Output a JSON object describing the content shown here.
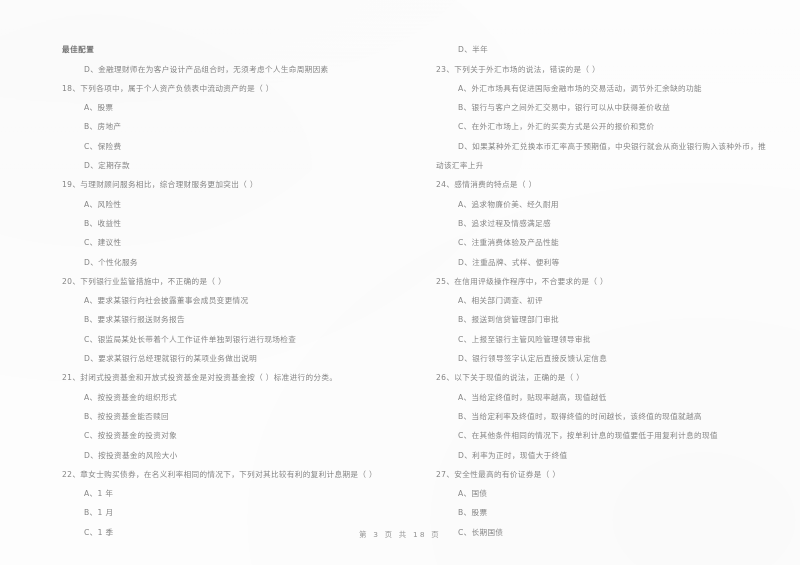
{
  "document": {
    "kind": "scanned-exam-paper",
    "language": "zh-CN",
    "ink_color": "#7b7b7b",
    "page_color": "#fdfdfd"
  },
  "left_column": {
    "lines": [
      {
        "kind": "heading",
        "text": "最佳配置"
      },
      {
        "kind": "option",
        "text": "D、金融理财师在为客户设计产品组合时，无须考虑个人生命周期因素"
      },
      {
        "kind": "stem",
        "text": "18、下列各项中，属于个人资产负债表中流动资产的是（      ）"
      },
      {
        "kind": "option",
        "text": "A、股票"
      },
      {
        "kind": "option",
        "text": "B、房地产"
      },
      {
        "kind": "option",
        "text": "C、保险费"
      },
      {
        "kind": "option",
        "text": "D、定期存款"
      },
      {
        "kind": "stem",
        "text": "19、与理财顾问服务相比，综合理财服务更加突出（      ）"
      },
      {
        "kind": "option",
        "text": "A、风险性"
      },
      {
        "kind": "option",
        "text": "B、收益性"
      },
      {
        "kind": "option",
        "text": "C、建议性"
      },
      {
        "kind": "option",
        "text": "D、个性化服务"
      },
      {
        "kind": "stem",
        "text": "20、下列银行业监管措施中，不正确的是（      ）"
      },
      {
        "kind": "option",
        "text": "A、要求某银行向社会披露董事会成员变更情况"
      },
      {
        "kind": "option",
        "text": "B、要求某银行报送财务报告"
      },
      {
        "kind": "option",
        "text": "C、银监局某处长带着个人工作证件单独到银行进行现场检查"
      },
      {
        "kind": "option",
        "text": "D、要求某银行总经理就银行的某项业务做出说明"
      },
      {
        "kind": "stem",
        "text": "21、封闭式投资基金和开放式投资基金是对投资基金按（      ）标准进行的分类。"
      },
      {
        "kind": "option",
        "text": "A、按投资基金的组织形式"
      },
      {
        "kind": "option",
        "text": "B、按投资基金能否赎回"
      },
      {
        "kind": "option",
        "text": "C、按投资基金的投资对象"
      },
      {
        "kind": "option",
        "text": "D、按投资基金的风险大小"
      },
      {
        "kind": "stem",
        "text": "22、章女士购买债券，在名义利率相同的情况下，下列对其比较有利的复利计息期是（      ）"
      },
      {
        "kind": "option",
        "text": "A、1 年"
      },
      {
        "kind": "option",
        "text": "B、1 月"
      },
      {
        "kind": "option",
        "text": "C、1 季"
      }
    ]
  },
  "right_column": {
    "lines": [
      {
        "kind": "option",
        "text": "D、半年"
      },
      {
        "kind": "stem",
        "text": "23、下列关于外汇市场的说法，错误的是（      ）"
      },
      {
        "kind": "option",
        "text": "A、外汇市场具有促进国际金融市场的交易活动，调节外汇余缺的功能"
      },
      {
        "kind": "option",
        "text": "B、银行与客户之间外汇交易中，银行可以从中获得差价收益"
      },
      {
        "kind": "option",
        "text": "C、在外汇市场上，外汇的买卖方式是公开的报价和竞价"
      },
      {
        "kind": "option",
        "text": "D、如果某种外汇兑换本币汇率高于预期值，中央银行就会从商业银行购入该种外币，推"
      },
      {
        "kind": "cont",
        "text": "动该汇率上升"
      },
      {
        "kind": "stem",
        "text": "24、感情消费的特点是（      ）"
      },
      {
        "kind": "option",
        "text": "A、追求物廉价美、经久耐用"
      },
      {
        "kind": "option",
        "text": "B、追求过程及情感满足感"
      },
      {
        "kind": "option",
        "text": "C、注重消费体验及产品性能"
      },
      {
        "kind": "option",
        "text": "D、注重品牌、式样、便利等"
      },
      {
        "kind": "stem",
        "text": "25、在信用评级操作程序中，不合要求的是（      ）"
      },
      {
        "kind": "option",
        "text": "A、相关部门调查、初评"
      },
      {
        "kind": "option",
        "text": "B、报送到信贷管理部门审批"
      },
      {
        "kind": "option",
        "text": "C、上报至银行主管风险管理领导审批"
      },
      {
        "kind": "option",
        "text": "D、银行领导签字认定后直接反馈认定信息"
      },
      {
        "kind": "stem",
        "text": "26、以下关于现值的说法，正确的是（      ）"
      },
      {
        "kind": "option",
        "text": "A、当给定终值时，贴现率越高，现值越低"
      },
      {
        "kind": "option",
        "text": "B、当给定利率及终值时，取得终值的时间越长，该终值的现值就越高"
      },
      {
        "kind": "option",
        "text": "C、在其他条件相同的情况下，按单利计息的现值要低于用复利计息的现值"
      },
      {
        "kind": "option",
        "text": "D、利率为正时，现值大于终值"
      },
      {
        "kind": "stem",
        "text": "27、安全性最高的有价证券是（      ）"
      },
      {
        "kind": "option",
        "text": "A、国债"
      },
      {
        "kind": "option",
        "text": "B、股票"
      },
      {
        "kind": "option",
        "text": "C、长期国债"
      }
    ]
  },
  "footer": {
    "text": "第 3 页 共 18 页"
  }
}
